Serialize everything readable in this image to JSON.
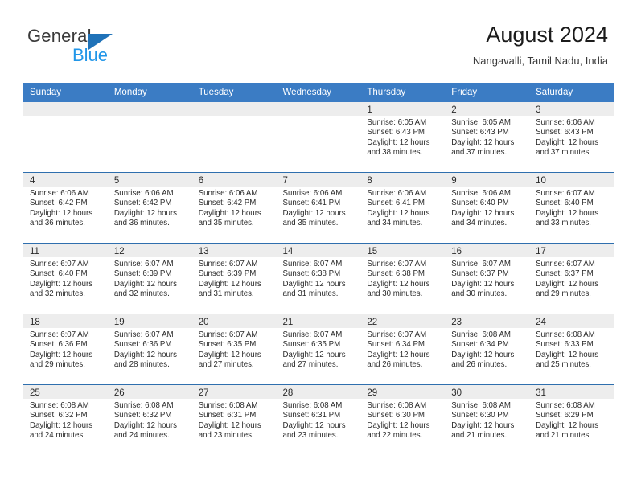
{
  "brand": {
    "name_top": "General",
    "name_bottom": "Blue",
    "logo_icon": "triangle-logo-icon",
    "accent_color": "#1f72b8",
    "blue_text_color": "#2196e8"
  },
  "header": {
    "title": "August 2024",
    "subtitle": "Nangavalli, Tamil Nadu, India"
  },
  "calendar": {
    "header_bg": "#3b7cc4",
    "header_text_color": "#ffffff",
    "day_band_bg": "#ededed",
    "row_divider_color": "#2f6fae",
    "weekdays": [
      "Sunday",
      "Monday",
      "Tuesday",
      "Wednesday",
      "Thursday",
      "Friday",
      "Saturday"
    ],
    "weeks": [
      [
        {
          "day": "",
          "lines": []
        },
        {
          "day": "",
          "lines": []
        },
        {
          "day": "",
          "lines": []
        },
        {
          "day": "",
          "lines": []
        },
        {
          "day": "1",
          "lines": [
            "Sunrise: 6:05 AM",
            "Sunset: 6:43 PM",
            "Daylight: 12 hours",
            "and 38 minutes."
          ]
        },
        {
          "day": "2",
          "lines": [
            "Sunrise: 6:05 AM",
            "Sunset: 6:43 PM",
            "Daylight: 12 hours",
            "and 37 minutes."
          ]
        },
        {
          "day": "3",
          "lines": [
            "Sunrise: 6:06 AM",
            "Sunset: 6:43 PM",
            "Daylight: 12 hours",
            "and 37 minutes."
          ]
        }
      ],
      [
        {
          "day": "4",
          "lines": [
            "Sunrise: 6:06 AM",
            "Sunset: 6:42 PM",
            "Daylight: 12 hours",
            "and 36 minutes."
          ]
        },
        {
          "day": "5",
          "lines": [
            "Sunrise: 6:06 AM",
            "Sunset: 6:42 PM",
            "Daylight: 12 hours",
            "and 36 minutes."
          ]
        },
        {
          "day": "6",
          "lines": [
            "Sunrise: 6:06 AM",
            "Sunset: 6:42 PM",
            "Daylight: 12 hours",
            "and 35 minutes."
          ]
        },
        {
          "day": "7",
          "lines": [
            "Sunrise: 6:06 AM",
            "Sunset: 6:41 PM",
            "Daylight: 12 hours",
            "and 35 minutes."
          ]
        },
        {
          "day": "8",
          "lines": [
            "Sunrise: 6:06 AM",
            "Sunset: 6:41 PM",
            "Daylight: 12 hours",
            "and 34 minutes."
          ]
        },
        {
          "day": "9",
          "lines": [
            "Sunrise: 6:06 AM",
            "Sunset: 6:40 PM",
            "Daylight: 12 hours",
            "and 34 minutes."
          ]
        },
        {
          "day": "10",
          "lines": [
            "Sunrise: 6:07 AM",
            "Sunset: 6:40 PM",
            "Daylight: 12 hours",
            "and 33 minutes."
          ]
        }
      ],
      [
        {
          "day": "11",
          "lines": [
            "Sunrise: 6:07 AM",
            "Sunset: 6:40 PM",
            "Daylight: 12 hours",
            "and 32 minutes."
          ]
        },
        {
          "day": "12",
          "lines": [
            "Sunrise: 6:07 AM",
            "Sunset: 6:39 PM",
            "Daylight: 12 hours",
            "and 32 minutes."
          ]
        },
        {
          "day": "13",
          "lines": [
            "Sunrise: 6:07 AM",
            "Sunset: 6:39 PM",
            "Daylight: 12 hours",
            "and 31 minutes."
          ]
        },
        {
          "day": "14",
          "lines": [
            "Sunrise: 6:07 AM",
            "Sunset: 6:38 PM",
            "Daylight: 12 hours",
            "and 31 minutes."
          ]
        },
        {
          "day": "15",
          "lines": [
            "Sunrise: 6:07 AM",
            "Sunset: 6:38 PM",
            "Daylight: 12 hours",
            "and 30 minutes."
          ]
        },
        {
          "day": "16",
          "lines": [
            "Sunrise: 6:07 AM",
            "Sunset: 6:37 PM",
            "Daylight: 12 hours",
            "and 30 minutes."
          ]
        },
        {
          "day": "17",
          "lines": [
            "Sunrise: 6:07 AM",
            "Sunset: 6:37 PM",
            "Daylight: 12 hours",
            "and 29 minutes."
          ]
        }
      ],
      [
        {
          "day": "18",
          "lines": [
            "Sunrise: 6:07 AM",
            "Sunset: 6:36 PM",
            "Daylight: 12 hours",
            "and 29 minutes."
          ]
        },
        {
          "day": "19",
          "lines": [
            "Sunrise: 6:07 AM",
            "Sunset: 6:36 PM",
            "Daylight: 12 hours",
            "and 28 minutes."
          ]
        },
        {
          "day": "20",
          "lines": [
            "Sunrise: 6:07 AM",
            "Sunset: 6:35 PM",
            "Daylight: 12 hours",
            "and 27 minutes."
          ]
        },
        {
          "day": "21",
          "lines": [
            "Sunrise: 6:07 AM",
            "Sunset: 6:35 PM",
            "Daylight: 12 hours",
            "and 27 minutes."
          ]
        },
        {
          "day": "22",
          "lines": [
            "Sunrise: 6:07 AM",
            "Sunset: 6:34 PM",
            "Daylight: 12 hours",
            "and 26 minutes."
          ]
        },
        {
          "day": "23",
          "lines": [
            "Sunrise: 6:08 AM",
            "Sunset: 6:34 PM",
            "Daylight: 12 hours",
            "and 26 minutes."
          ]
        },
        {
          "day": "24",
          "lines": [
            "Sunrise: 6:08 AM",
            "Sunset: 6:33 PM",
            "Daylight: 12 hours",
            "and 25 minutes."
          ]
        }
      ],
      [
        {
          "day": "25",
          "lines": [
            "Sunrise: 6:08 AM",
            "Sunset: 6:32 PM",
            "Daylight: 12 hours",
            "and 24 minutes."
          ]
        },
        {
          "day": "26",
          "lines": [
            "Sunrise: 6:08 AM",
            "Sunset: 6:32 PM",
            "Daylight: 12 hours",
            "and 24 minutes."
          ]
        },
        {
          "day": "27",
          "lines": [
            "Sunrise: 6:08 AM",
            "Sunset: 6:31 PM",
            "Daylight: 12 hours",
            "and 23 minutes."
          ]
        },
        {
          "day": "28",
          "lines": [
            "Sunrise: 6:08 AM",
            "Sunset: 6:31 PM",
            "Daylight: 12 hours",
            "and 23 minutes."
          ]
        },
        {
          "day": "29",
          "lines": [
            "Sunrise: 6:08 AM",
            "Sunset: 6:30 PM",
            "Daylight: 12 hours",
            "and 22 minutes."
          ]
        },
        {
          "day": "30",
          "lines": [
            "Sunrise: 6:08 AM",
            "Sunset: 6:30 PM",
            "Daylight: 12 hours",
            "and 21 minutes."
          ]
        },
        {
          "day": "31",
          "lines": [
            "Sunrise: 6:08 AM",
            "Sunset: 6:29 PM",
            "Daylight: 12 hours",
            "and 21 minutes."
          ]
        }
      ]
    ]
  }
}
